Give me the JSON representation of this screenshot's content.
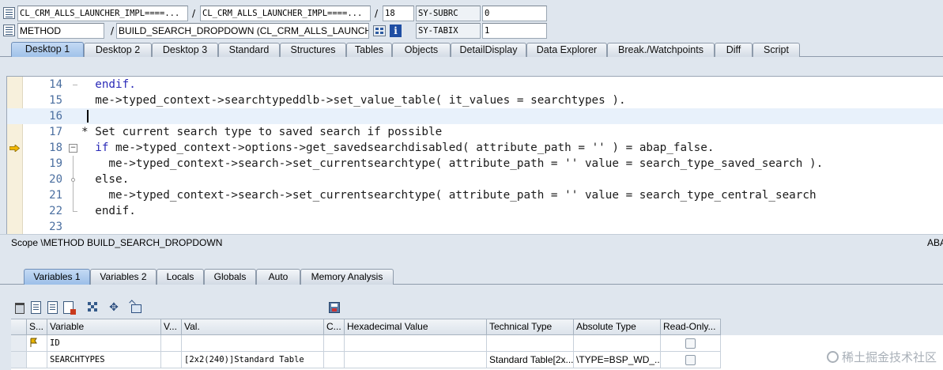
{
  "context": {
    "row1": {
      "program": "CL_CRM_ALLS_LAUNCHER_IMPL====...",
      "include": "CL_CRM_ALLS_LAUNCHER_IMPL====...",
      "line": "18",
      "sysfield": "SY-SUBRC",
      "sysvalue": "0"
    },
    "row2": {
      "event_type": "METHOD",
      "event": "BUILD_SEARCH_DROPDOWN (CL_CRM_ALLS_LAUNCHE...",
      "sysfield": "SY-TABIX",
      "sysvalue": "1"
    },
    "sep": "/"
  },
  "desktop_tabs": [
    "Desktop 1",
    "Desktop 2",
    "Desktop 3",
    "Standard",
    "Structures",
    "Tables",
    "Objects",
    "DetailDisplay",
    "Data Explorer",
    "Break./Watchpoints",
    "Diff",
    "Script"
  ],
  "editor": {
    "lines": [
      {
        "num": "14",
        "text": "  endif."
      },
      {
        "num": "15",
        "text": "  me->typed_context->searchtypeddlb->set_value_table( it_values = searchtypes )."
      },
      {
        "num": "16",
        "text": ""
      },
      {
        "num": "17",
        "text": "* Set current search type to saved search if possible"
      },
      {
        "num": "18",
        "text": "  if me->typed_context->options->get_savedsearchdisabled( attribute_path = '' ) = abap_false."
      },
      {
        "num": "19",
        "text": "    me->typed_context->search->set_currentsearchtype( attribute_path = '' value = search_type_saved_search )."
      },
      {
        "num": "20",
        "text": "  else."
      },
      {
        "num": "21",
        "text": "    me->typed_context->search->set_currentsearchtype( attribute_path = '' value = search_type_central_search"
      },
      {
        "num": "22",
        "text": "  endif."
      },
      {
        "num": "23",
        "text": ""
      }
    ]
  },
  "scope": {
    "text": "Scope \\METHOD BUILD_SEARCH_DROPDOWN",
    "lang": "ABA"
  },
  "var_tabs": [
    "Variables 1",
    "Variables 2",
    "Locals",
    "Globals",
    "Auto",
    "Memory Analysis"
  ],
  "grid": {
    "columns": [
      "S...",
      "Variable",
      "V...",
      "Val.",
      "C...",
      "Hexadecimal Value",
      "Technical Type",
      "Absolute Type",
      "Read-Only..."
    ],
    "rows": [
      {
        "variable": "ID",
        "val": "",
        "hex": "",
        "tech": "",
        "abs": ""
      },
      {
        "variable": "SEARCHTYPES",
        "val": "[2x2(240)]Standard Table",
        "hex": "",
        "tech": "Standard Table[2x...",
        "abs": "\\TYPE=BSP_WD_..."
      }
    ]
  },
  "watermark": "稀土掘金技术社区",
  "colors": {
    "accent": "#9cbfe8",
    "breakpoint_gutter": "#f7f0dc",
    "keyword": "#2b2bb8",
    "comment": "#8b8f97"
  }
}
